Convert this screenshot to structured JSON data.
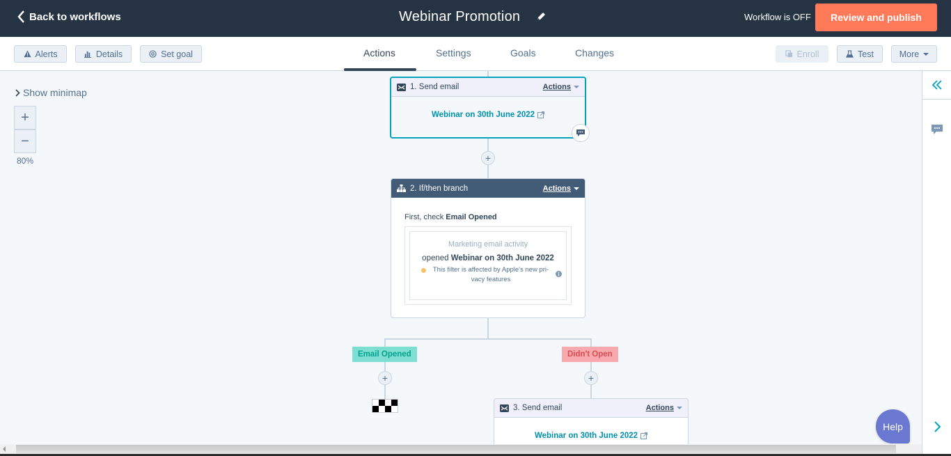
{
  "header": {
    "back_label": "Back to workflows",
    "title": "Webinar Promotion",
    "status": "Workflow is OFF",
    "publish_label": "Review and publish",
    "accent_color": "#ff7a59"
  },
  "toolbar": {
    "left_buttons": [
      {
        "label": "Alerts",
        "icon": "warning-icon"
      },
      {
        "label": "Details",
        "icon": "bar-chart-icon"
      },
      {
        "label": "Set goal",
        "icon": "target-icon"
      }
    ],
    "tabs": [
      {
        "label": "Actions",
        "active": true
      },
      {
        "label": "Settings",
        "active": false
      },
      {
        "label": "Goals",
        "active": false
      },
      {
        "label": "Changes",
        "active": false
      }
    ],
    "right_buttons": [
      {
        "label": "Enroll",
        "icon": "enroll-icon",
        "disabled": true
      },
      {
        "label": "Test",
        "icon": "flask-icon",
        "disabled": false
      },
      {
        "label": "More",
        "icon": "caret-down-icon",
        "disabled": false
      }
    ]
  },
  "canvas": {
    "minimap_label": "Show minimap",
    "zoom_in": "+",
    "zoom_out": "−",
    "zoom_level": "80%",
    "plus": "+",
    "steps": [
      {
        "title": "1. Send email",
        "actions_label": "Actions",
        "email_link": "Webinar on 30th June 2022"
      },
      {
        "title": "2. If/then branch",
        "actions_label": "Actions",
        "check_prefix": "First, check",
        "check_name": "Email Opened",
        "filter_category": "Marketing email activity",
        "filter_verb": "opened",
        "filter_value": "Webinar on 30th June 2022",
        "warning": "This filter is affected by Apple's new pri-vacy features"
      },
      {
        "title": "3. Send email",
        "actions_label": "Actions",
        "email_link": "Webinar on 30th June 2022"
      }
    ],
    "branches": [
      {
        "label": "Email Opened",
        "bg": "#7fded2",
        "color": "#00a38d"
      },
      {
        "label": "Didn't Open",
        "bg": "#f8a9ad",
        "color": "#d94c53"
      }
    ]
  },
  "help_label": "Help"
}
